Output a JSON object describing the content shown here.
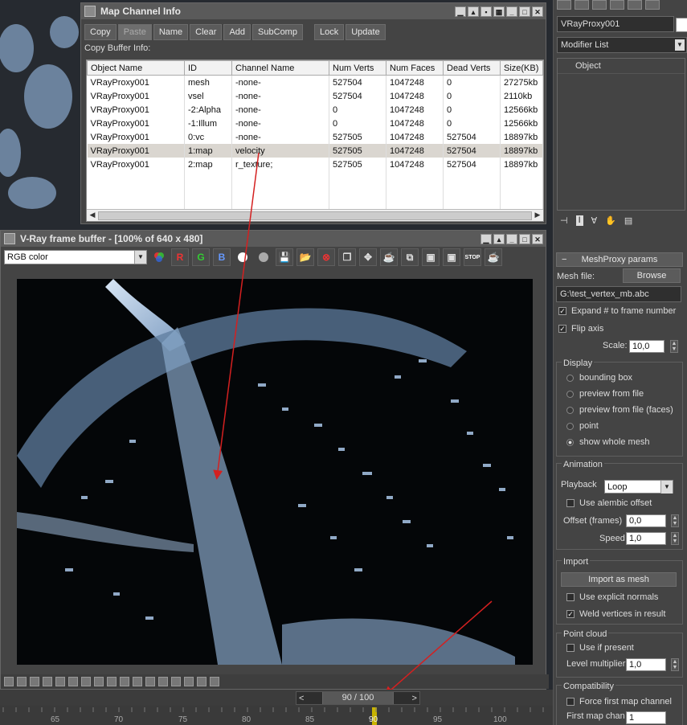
{
  "map_channel_window": {
    "title": "Map Channel Info",
    "toolbar": [
      "Copy",
      "Paste",
      "Name",
      "Clear",
      "Add",
      "SubComp",
      "Lock",
      "Update"
    ],
    "copy_buffer_label": "Copy Buffer Info:",
    "columns": [
      "Object Name",
      "ID",
      "Channel Name",
      "Num Verts",
      "Num Faces",
      "Dead Verts",
      "Size(KB)"
    ],
    "rows": [
      [
        "VRayProxy001",
        "mesh",
        "-none-",
        "527504",
        "1047248",
        "0",
        "27275kb"
      ],
      [
        "VRayProxy001",
        "vsel",
        "-none-",
        "527504",
        "1047248",
        "0",
        "2110kb"
      ],
      [
        "VRayProxy001",
        "-2:Alpha",
        "-none-",
        "0",
        "1047248",
        "0",
        "12566kb"
      ],
      [
        "VRayProxy001",
        "-1:Illum",
        "-none-",
        "0",
        "1047248",
        "0",
        "12566kb"
      ],
      [
        "VRayProxy001",
        "0:vc",
        "-none-",
        "527505",
        "1047248",
        "527504",
        "18897kb"
      ],
      [
        "VRayProxy001",
        "1:map",
        "velocity",
        "527505",
        "1047248",
        "527504",
        "18897kb"
      ],
      [
        "VRayProxy001",
        "2:map",
        "r_texture;",
        "527505",
        "1047248",
        "527504",
        "18897kb"
      ]
    ],
    "selected_row": 5
  },
  "vfb": {
    "title": "V-Ray frame buffer - [100% of 640 x 480]",
    "channel": "RGB color",
    "buttons": [
      "R",
      "G",
      "B"
    ]
  },
  "timeline": {
    "frame_display": "90 / 100",
    "prev": "<",
    "next": ">",
    "ruler": [
      "65",
      "70",
      "75",
      "80",
      "85",
      "90",
      "95",
      "100"
    ]
  },
  "command_panel": {
    "object_name": "VRayProxy001",
    "modifier_list": "Modifier List",
    "stack_item": "Object",
    "rollout_title": "MeshProxy params",
    "mesh_file_label": "Mesh file:",
    "browse": "Browse",
    "mesh_file_path": "G:\\test_vertex_mb.abc",
    "expand_label": "Expand # to frame number",
    "flip_axis": "Flip axis",
    "scale_label": "Scale:",
    "scale_value": "10,0",
    "display": {
      "title": "Display",
      "options": [
        "bounding box",
        "preview from file",
        "preview from file (faces)",
        "point",
        "show whole mesh"
      ],
      "selected": 4
    },
    "animation": {
      "title": "Animation",
      "playback_label": "Playback",
      "playback_value": "Loop",
      "use_alembic_offset": "Use alembic offset",
      "offset_label": "Offset (frames)",
      "offset_value": "0,0",
      "speed_label": "Speed",
      "speed_value": "1,0"
    },
    "import": {
      "title": "Import",
      "button": "Import as mesh",
      "explicit_normals": "Use explicit normals",
      "weld": "Weld vertices in result"
    },
    "point_cloud": {
      "title": "Point cloud",
      "use_if_present": "Use if present",
      "level_label": "Level multiplier",
      "level_value": "1,0"
    },
    "compatibility": {
      "title": "Compatibility",
      "force_first": "Force first map channel",
      "first_map_label": "First map chan",
      "first_map_value": "1"
    }
  },
  "colors": {
    "annotation_arrow": "#d42020",
    "water": "#a9c6e8"
  }
}
